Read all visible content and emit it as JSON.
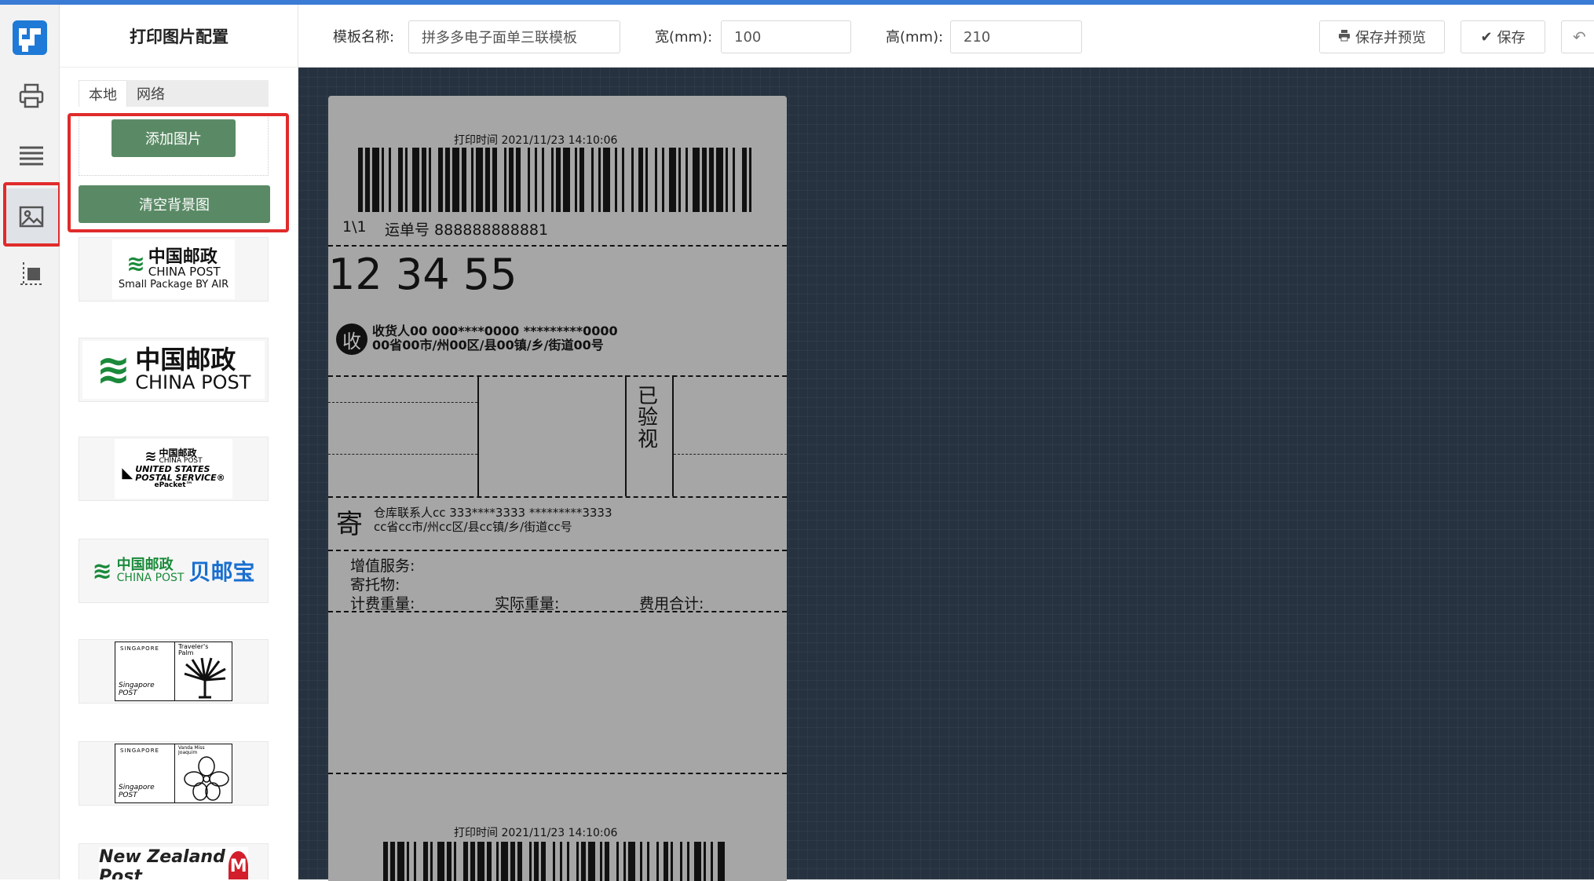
{
  "colors": {
    "accent": "#3a7bd5",
    "green_button": "#5a8a65",
    "canvas_bg": "#263240",
    "paper_bg": "#a6a6a6",
    "highlight": "#e02b2b"
  },
  "panel": {
    "title": "打印图片配置",
    "tabs": [
      "本地",
      "网络"
    ],
    "add_image_label": "添加图片",
    "clear_bg_label": "清空背景图",
    "logos": [
      {
        "name": "china-post-small-package",
        "lines": [
          "中国邮政",
          "CHINA POST",
          "Small Package BY AIR"
        ]
      },
      {
        "name": "china-post",
        "lines": [
          "中国邮政",
          "CHINA POST"
        ]
      },
      {
        "name": "china-post-usps",
        "lines": [
          "中国邮政",
          "CHINA POST",
          "UNITED STATES",
          "POSTAL SERVICE®",
          "ePacket™"
        ]
      },
      {
        "name": "china-post-beiyoubao",
        "lines": [
          "中国邮政",
          "CHINA POST",
          "贝邮宝"
        ]
      },
      {
        "name": "singapore-post-travelers-palm",
        "lines": [
          "SINGAPORE",
          "Traveler's Palm",
          "Singapore POST"
        ]
      },
      {
        "name": "singapore-post-vanda",
        "lines": [
          "SINGAPORE",
          "Vanda Miss Joaquim",
          "Singapore POST"
        ]
      },
      {
        "name": "new-zealand-post",
        "lines": [
          "New Zealand Post"
        ]
      }
    ]
  },
  "toolbar": {
    "template_name_label": "模板名称:",
    "template_name_value": "拼多多电子面单三联模板",
    "width_label": "宽(mm):",
    "width_value": "100",
    "height_label": "高(mm):",
    "height_value": "210",
    "save_preview_label": "保存并预览",
    "save_label": "保存"
  },
  "label": {
    "print_time": "打印时间  2021/11/23   14:10:06",
    "count": "1\\1",
    "waybill": "运单号 888888888881",
    "sort_code": "12  34  55",
    "receive_char": "收",
    "receiver_line1": "收货人00  000****0000  *********0000",
    "receiver_line2": "00省00市/州00区/县00镇/乡/街道00号",
    "verified": [
      "已",
      "验",
      "视"
    ],
    "send_char": "寄",
    "sender_line1": "仓库联系人cc  333****3333  *********3333",
    "sender_line2": "cc省cc市/州cc区/县cc镇/乡/街道cc号",
    "value_added": "增值服务:",
    "consignment": "寄托物:",
    "charge_weight": "计费重量:",
    "actual_weight": "实际重量:",
    "total_fee": "费用合计:",
    "print_time_2": "打印时间  2021/11/23   14:10:06"
  }
}
